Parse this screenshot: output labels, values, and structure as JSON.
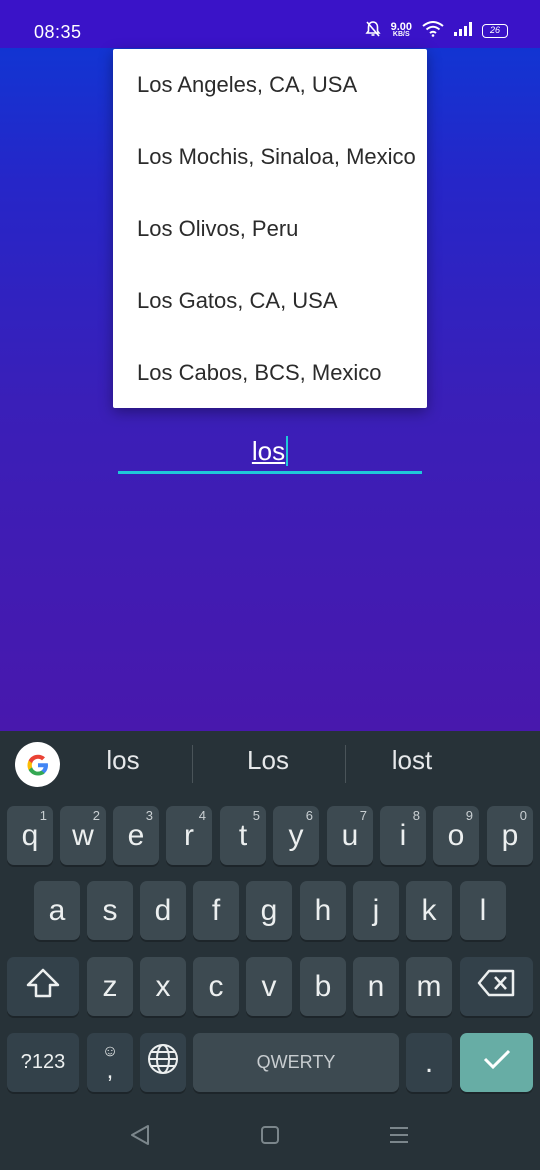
{
  "status_bar": {
    "time": "08:35",
    "net_speed_value": "9.00",
    "net_speed_unit": "KB/S",
    "battery_level": "26",
    "icons": [
      "bell-off-icon",
      "wifi-icon",
      "signal-icon",
      "battery-icon"
    ]
  },
  "dropdown": {
    "items": [
      {
        "label": "Los Angeles, CA, USA"
      },
      {
        "label": "Los Mochis, Sinaloa, Mexico"
      },
      {
        "label": "Los Olivos, Peru"
      },
      {
        "label": "Los Gatos, CA, USA"
      },
      {
        "label": "Los Cabos, BCS, Mexico"
      }
    ]
  },
  "input": {
    "value": "los",
    "underline_color": "#1fc9d9"
  },
  "keyboard": {
    "suggestions": [
      "los",
      "Los",
      "lost"
    ],
    "row1": [
      {
        "key": "q",
        "hint": "1"
      },
      {
        "key": "w",
        "hint": "2"
      },
      {
        "key": "e",
        "hint": "3"
      },
      {
        "key": "r",
        "hint": "4"
      },
      {
        "key": "t",
        "hint": "5"
      },
      {
        "key": "y",
        "hint": "6"
      },
      {
        "key": "u",
        "hint": "7"
      },
      {
        "key": "i",
        "hint": "8"
      },
      {
        "key": "o",
        "hint": "9"
      },
      {
        "key": "p",
        "hint": "0"
      }
    ],
    "row2": [
      "a",
      "s",
      "d",
      "f",
      "g",
      "h",
      "j",
      "k",
      "l"
    ],
    "row3": [
      "z",
      "x",
      "c",
      "v",
      "b",
      "n",
      "m"
    ],
    "symbols_label": "?123",
    "comma_label": ",",
    "space_label": "QWERTY",
    "period_label": ".",
    "enter_color": "#67ada5"
  },
  "navigation": {
    "icons": [
      "back-icon",
      "home-icon",
      "recents-icon"
    ]
  }
}
